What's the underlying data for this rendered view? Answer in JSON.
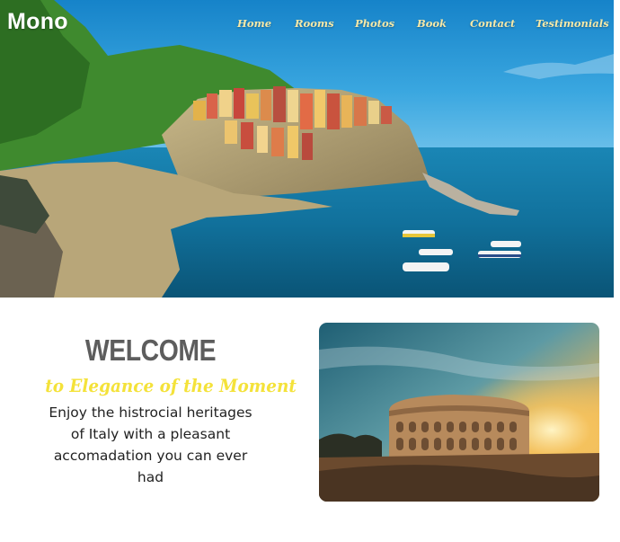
{
  "brand": {
    "logo": "Mono"
  },
  "nav": {
    "items": [
      {
        "label": "Home"
      },
      {
        "label": "Rooms"
      },
      {
        "label": "Photos"
      },
      {
        "label": "Book"
      },
      {
        "label": "Contact"
      },
      {
        "label": "Testimonials"
      }
    ]
  },
  "welcome": {
    "heading": "WELCOME",
    "tagline": "to Elegance of the Moment",
    "description": "Enjoy the histrocial heritages of Italy with a pleasant accomadation you can ever had"
  },
  "colors": {
    "nav_text": "#f7e9a8",
    "tagline": "#f4e23a",
    "heading": "#5d5d5d"
  }
}
